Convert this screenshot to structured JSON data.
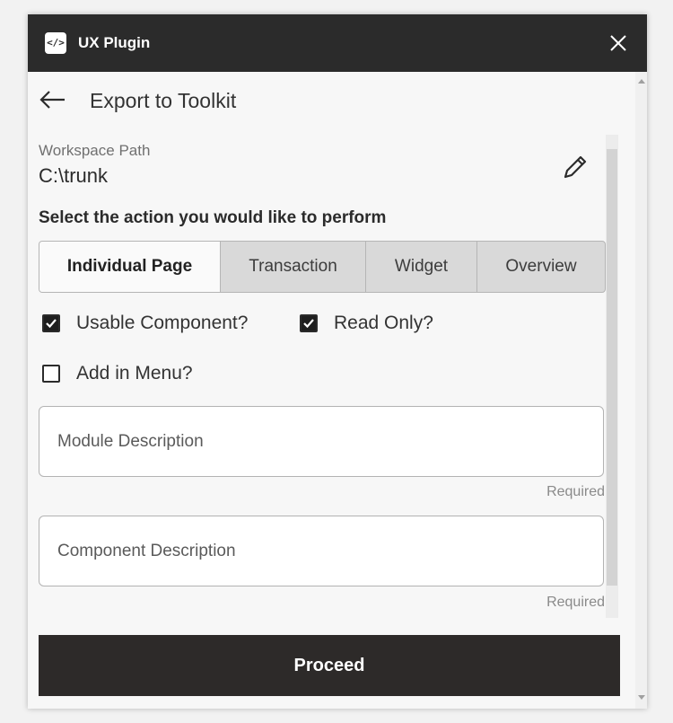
{
  "window": {
    "app_icon_glyph": "</>",
    "title": "UX Plugin"
  },
  "header": {
    "page_title": "Export to Toolkit"
  },
  "workspace": {
    "label": "Workspace Path",
    "value": "C:\\trunk"
  },
  "action": {
    "prompt": "Select the action you would like to perform",
    "tabs": [
      {
        "label": "Individual Page",
        "active": true
      },
      {
        "label": "Transaction",
        "active": false
      },
      {
        "label": "Widget",
        "active": false
      },
      {
        "label": "Overview",
        "active": false
      }
    ]
  },
  "options": {
    "usable_component": {
      "label": "Usable Component?",
      "checked": true
    },
    "read_only": {
      "label": "Read Only?",
      "checked": true
    },
    "add_in_menu": {
      "label": "Add in Menu?",
      "checked": false
    }
  },
  "fields": {
    "module_description": {
      "placeholder": "Module Description",
      "value": "",
      "hint": "Required"
    },
    "component_description": {
      "placeholder": "Component Description",
      "value": "",
      "hint": "Required"
    }
  },
  "footer": {
    "proceed_label": "Proceed"
  },
  "colors": {
    "titlebar": "#2b2b2b",
    "primary_button": "#2d2a29",
    "active_tab": "#fafafa",
    "inactive_tab": "#d9d9d9"
  },
  "icons": {
    "app": "code-icon",
    "close": "close-icon",
    "back": "arrow-left-icon",
    "edit": "pencil-icon",
    "check": "checkmark-icon"
  }
}
